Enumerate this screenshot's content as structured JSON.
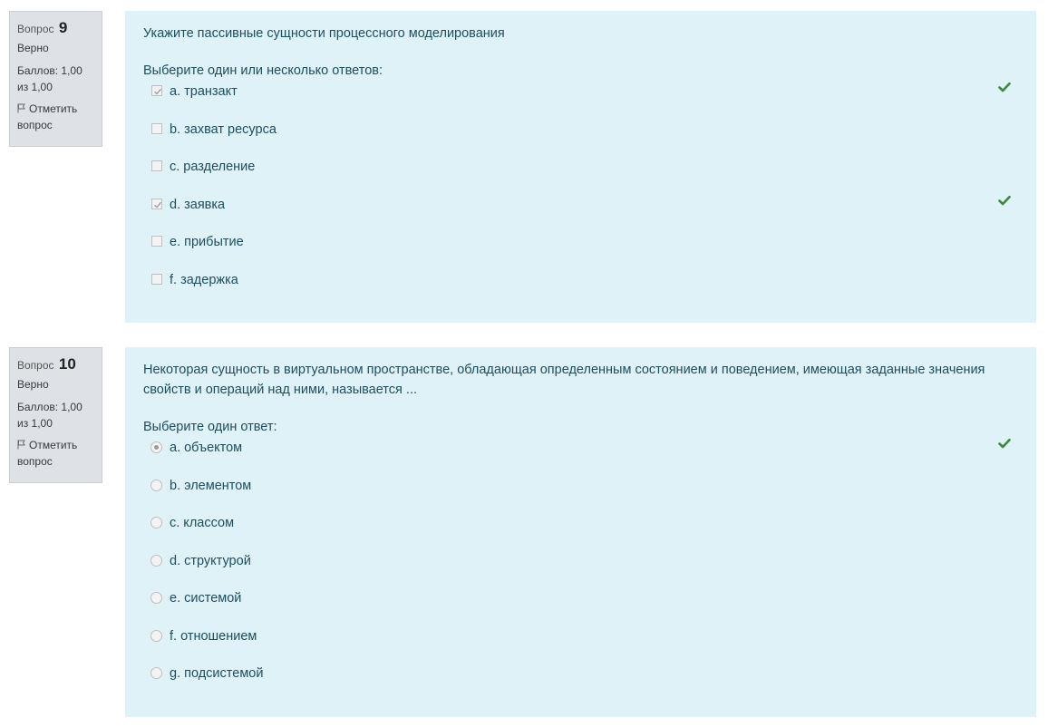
{
  "questions": [
    {
      "label": "Вопрос",
      "number": "9",
      "state": "Верно",
      "grade": "Баллов: 1,00 из 1,00",
      "flag_label": "Отметить вопрос",
      "text": "Укажите пассивные сущности процессного моделирования",
      "prompt": "Выберите один или несколько ответов:",
      "type": "checkbox",
      "options": [
        {
          "label": "a. транзакт",
          "checked": true,
          "correct": true
        },
        {
          "label": "b. захват ресурса",
          "checked": false,
          "correct": false
        },
        {
          "label": "c. разделение",
          "checked": false,
          "correct": false
        },
        {
          "label": "d. заявка",
          "checked": true,
          "correct": true
        },
        {
          "label": "e. прибытие",
          "checked": false,
          "correct": false
        },
        {
          "label": "f. задержка",
          "checked": false,
          "correct": false
        }
      ]
    },
    {
      "label": "Вопрос",
      "number": "10",
      "state": "Верно",
      "grade": "Баллов: 1,00 из 1,00",
      "flag_label": "Отметить вопрос",
      "text": "Некоторая сущность в виртуальном пространстве, обладающая определенным состоянием и поведением, имеющая заданные значения свойств и операций над ними, называется ...",
      "prompt": "Выберите один ответ:",
      "type": "radio",
      "options": [
        {
          "label": "a. объектом",
          "checked": true,
          "correct": true
        },
        {
          "label": "b. элементом",
          "checked": false,
          "correct": false
        },
        {
          "label": "c. классом",
          "checked": false,
          "correct": false
        },
        {
          "label": "d. структурой",
          "checked": false,
          "correct": false
        },
        {
          "label": "e. системой",
          "checked": false,
          "correct": false
        },
        {
          "label": "f. отношением",
          "checked": false,
          "correct": false
        },
        {
          "label": "g. подсистемой",
          "checked": false,
          "correct": false
        }
      ]
    }
  ],
  "icons": {
    "flag": "flag-icon",
    "correct": "check-icon"
  },
  "colors": {
    "correct": "#3d8b3d",
    "content_bg": "#def2f8",
    "info_bg": "#dee2e6",
    "text": "#1d4e5f"
  }
}
